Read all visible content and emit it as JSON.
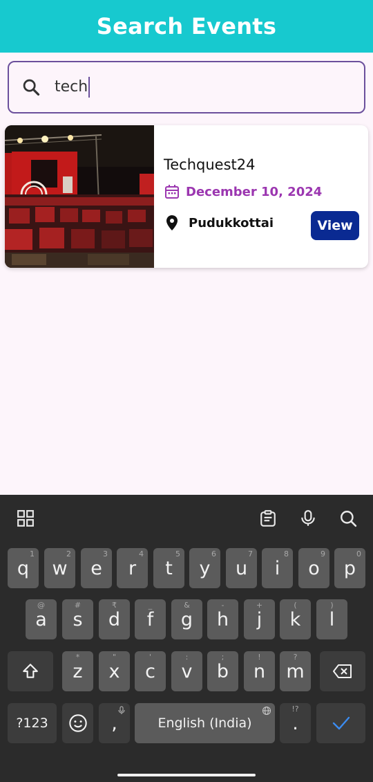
{
  "app_bar": {
    "title": "Search Events"
  },
  "search": {
    "value": "tech",
    "icon": "search-icon"
  },
  "event": {
    "name": "Techquest24",
    "date": "December 10, 2024",
    "location": "Pudukkottai",
    "view_label": "View"
  },
  "keyboard": {
    "row1": [
      {
        "label": "q",
        "hint": "1"
      },
      {
        "label": "w",
        "hint": "2"
      },
      {
        "label": "e",
        "hint": "3"
      },
      {
        "label": "r",
        "hint": "4"
      },
      {
        "label": "t",
        "hint": "5"
      },
      {
        "label": "y",
        "hint": "6"
      },
      {
        "label": "u",
        "hint": "7"
      },
      {
        "label": "i",
        "hint": "8"
      },
      {
        "label": "o",
        "hint": "9"
      },
      {
        "label": "p",
        "hint": "0"
      }
    ],
    "row2": [
      {
        "label": "a",
        "hint": "@"
      },
      {
        "label": "s",
        "hint": "#"
      },
      {
        "label": "d",
        "hint": "₹"
      },
      {
        "label": "f",
        "hint": "_"
      },
      {
        "label": "g",
        "hint": "&"
      },
      {
        "label": "h",
        "hint": "-"
      },
      {
        "label": "j",
        "hint": "+"
      },
      {
        "label": "k",
        "hint": "("
      },
      {
        "label": "l",
        "hint": ")"
      }
    ],
    "row3": [
      {
        "label": "z",
        "hint": "*"
      },
      {
        "label": "x",
        "hint": "\""
      },
      {
        "label": "c",
        "hint": "'"
      },
      {
        "label": "v",
        "hint": ":"
      },
      {
        "label": "b",
        "hint": ";"
      },
      {
        "label": "n",
        "hint": "!"
      },
      {
        "label": "m",
        "hint": "?"
      }
    ],
    "symbols_label": "?123",
    "comma_label": ",",
    "space_label": "English (India)",
    "period_label": ".",
    "period_hint": "!?",
    "colors": {
      "accent_blue": "#3b8cf0"
    }
  },
  "colors": {
    "app_bar": "#17c9cf",
    "date": "#9b36b0",
    "view_button": "#0a2a92"
  }
}
